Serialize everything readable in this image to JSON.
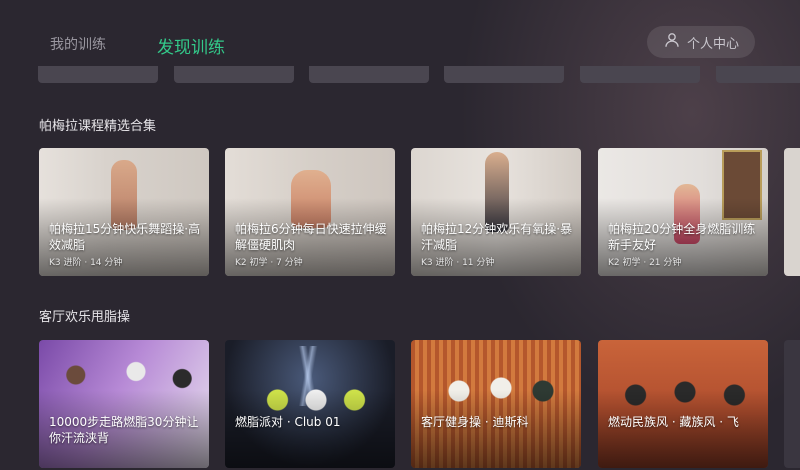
{
  "nav": {
    "tabs": [
      {
        "label": "我的训练",
        "active": false
      },
      {
        "label": "发现训练",
        "active": true
      }
    ],
    "user_center_label": "个人中心"
  },
  "sections": [
    {
      "title": "帕梅拉课程精选合集",
      "cards": [
        {
          "title": "帕梅拉15分钟快乐舞蹈操·高效减脂",
          "meta": "K3 进阶 · 14 分钟"
        },
        {
          "title": "帕梅拉6分钟每日快速拉伸缓解僵硬肌肉",
          "meta": "K2 初学 · 7 分钟"
        },
        {
          "title": "帕梅拉12分钟欢乐有氧操·暴汗减脂",
          "meta": "K3 进阶 · 11 分钟"
        },
        {
          "title": "帕梅拉20分钟全身燃脂训练 新手友好",
          "meta": "K2 初学 · 21 分钟"
        }
      ]
    },
    {
      "title": "客厅欢乐甩脂操",
      "cards": [
        {
          "title": "10000步走路燃脂30分钟让你汗流浃背",
          "meta": ""
        },
        {
          "title": "燃脂派对 · Club 01",
          "meta": ""
        },
        {
          "title": "客厅健身操 · 迪斯科",
          "meta": ""
        },
        {
          "title": "燃动民族风 · 藏族风 · 飞",
          "meta": ""
        }
      ]
    }
  ],
  "colors": {
    "accent": "#33c98a",
    "background": "#2b2730"
  }
}
